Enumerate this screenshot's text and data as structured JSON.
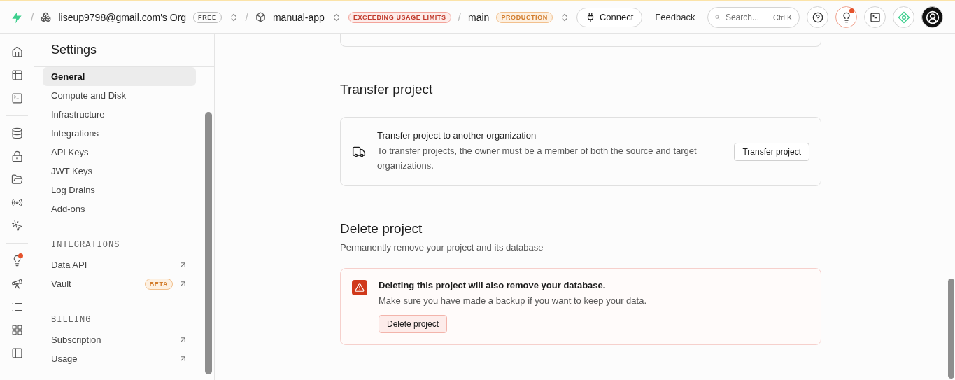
{
  "topbar": {
    "org": {
      "separator": "/",
      "name": "liseup9798@gmail.com's Org",
      "badge": "FREE"
    },
    "project": {
      "separator": "/",
      "name": "manual-app",
      "badge": "EXCEEDING USAGE LIMITS"
    },
    "branch": {
      "separator": "/",
      "name": "main",
      "badge": "PRODUCTION"
    },
    "connect": "Connect",
    "feedback": "Feedback",
    "search": {
      "placeholder": "Search...",
      "shortcut": "Ctrl K"
    },
    "tips_alert": true
  },
  "rail": {
    "tips_alert": true
  },
  "sidebar": {
    "title": "Settings",
    "sections": [
      {
        "items": [
          {
            "label": "General",
            "selected": true
          },
          {
            "label": "Compute and Disk",
            "selected": false
          },
          {
            "label": "Infrastructure",
            "selected": false
          },
          {
            "label": "Integrations",
            "selected": false
          },
          {
            "label": "API Keys",
            "selected": false
          },
          {
            "label": "JWT Keys",
            "selected": false
          },
          {
            "label": "Log Drains",
            "selected": false
          },
          {
            "label": "Add-ons",
            "selected": false
          }
        ]
      },
      {
        "heading": "INTEGRATIONS",
        "items": [
          {
            "label": "Data API",
            "selected": false,
            "external": true
          },
          {
            "label": "Vault",
            "selected": false,
            "external": true,
            "badge": "BETA"
          }
        ]
      },
      {
        "heading": "BILLING",
        "items": [
          {
            "label": "Subscription",
            "selected": false,
            "external": true
          },
          {
            "label": "Usage",
            "selected": false,
            "external": true
          }
        ]
      }
    ]
  },
  "main": {
    "transfer": {
      "heading": "Transfer project",
      "title": "Transfer project to another organization",
      "description": "To transfer projects, the owner must be a member of both the source and target organizations.",
      "button": "Transfer project"
    },
    "delete": {
      "heading": "Delete project",
      "subtitle": "Permanently remove your project and its database",
      "title": "Deleting this project will also remove your database.",
      "description": "Make sure you have made a backup if you want to keep your data.",
      "button": "Delete project"
    }
  }
}
